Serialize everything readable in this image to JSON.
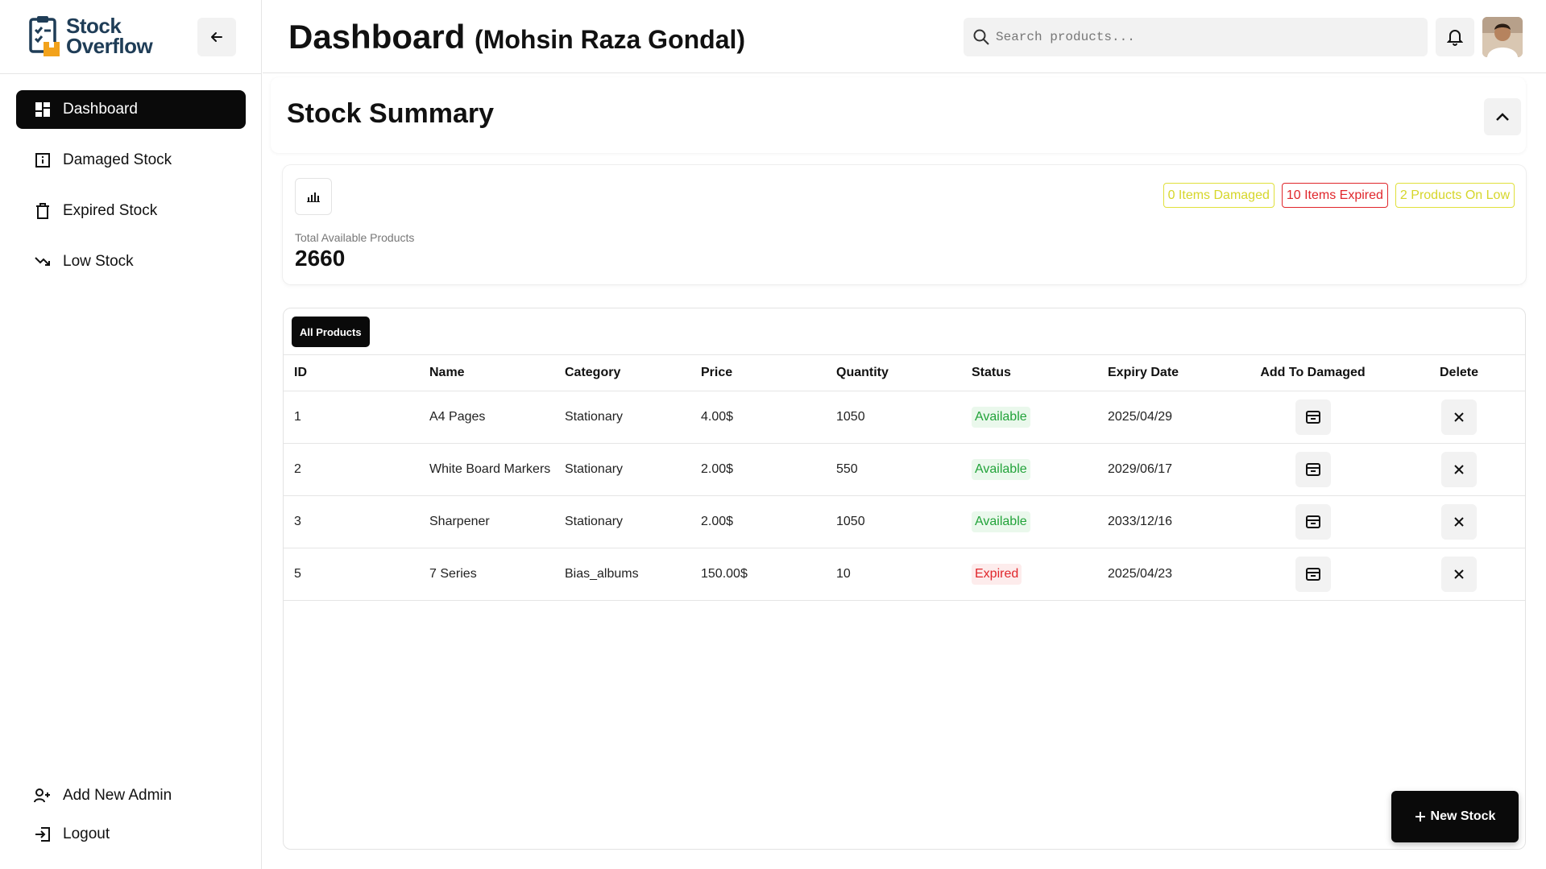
{
  "brand": {
    "line1": "Stock",
    "line2": "Overflow",
    "logo_icon": "clipboard-box-icon"
  },
  "sidebar": {
    "collapse_icon": "arrow-left-icon",
    "items": [
      {
        "label": "Dashboard",
        "icon": "grid-icon",
        "active": true
      },
      {
        "label": "Damaged Stock",
        "icon": "info-square-icon",
        "active": false
      },
      {
        "label": "Expired Stock",
        "icon": "trash-icon",
        "active": false
      },
      {
        "label": "Low Stock",
        "icon": "trending-down-icon",
        "active": false
      }
    ],
    "bottom_items": [
      {
        "label": "Add New Admin",
        "icon": "user-plus-icon"
      },
      {
        "label": "Logout",
        "icon": "logout-icon"
      }
    ]
  },
  "header": {
    "title": "Dashboard",
    "subtitle": "(Mohsin Raza Gondal)",
    "search_placeholder": "Search products..."
  },
  "summary": {
    "title": "Stock Summary",
    "total_label": "Total Available Products",
    "total_value": "2660",
    "badges": [
      {
        "text": "0 Items Damaged",
        "color": "#d6d62a"
      },
      {
        "text": "10 Items Expired",
        "color": "#e0262b"
      },
      {
        "text": "2 Products On Low",
        "color": "#d6d62a"
      }
    ]
  },
  "table": {
    "tab_label": "All Products",
    "columns": [
      "ID",
      "Name",
      "Category",
      "Price",
      "Quantity",
      "Status",
      "Expiry Date",
      "Add To Damaged",
      "Delete"
    ],
    "rows": [
      {
        "id": "1",
        "name": "A4 Pages",
        "category": "Stationary",
        "price": "4.00$",
        "quantity": "1050",
        "status": "Available",
        "expiry": "2025/04/29"
      },
      {
        "id": "2",
        "name": "White Board Markers",
        "category": "Stationary",
        "price": "2.00$",
        "quantity": "550",
        "status": "Available",
        "expiry": "2029/06/17"
      },
      {
        "id": "3",
        "name": "Sharpener",
        "category": "Stationary",
        "price": "2.00$",
        "quantity": "1050",
        "status": "Available",
        "expiry": "2033/12/16"
      },
      {
        "id": "5",
        "name": "7 Series",
        "category": "Bias_albums",
        "price": "150.00$",
        "quantity": "10",
        "status": "Expired",
        "expiry": "2025/04/23"
      }
    ]
  },
  "new_stock_label": "New Stock",
  "colors": {
    "available_text": "#22a33a",
    "available_bg": "#eaf8ec",
    "expired_text": "#e0262b",
    "expired_bg": "#fdecec"
  }
}
